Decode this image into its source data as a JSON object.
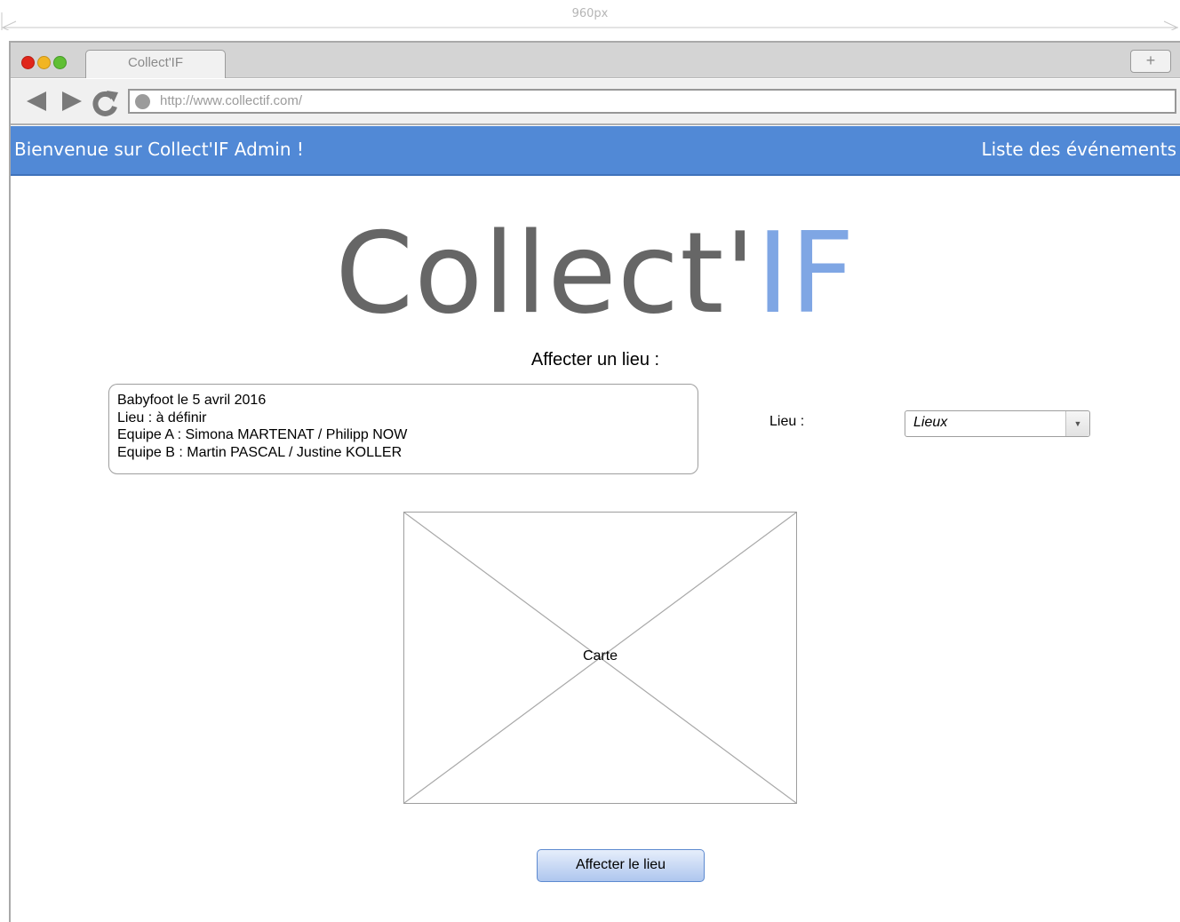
{
  "ruler": {
    "label": "960px"
  },
  "browser": {
    "tab_title": "Collect'IF",
    "new_tab_label": "+",
    "url": "http://www.collectif.com/"
  },
  "header": {
    "welcome": "Bienvenue sur Collect'IF Admin !",
    "events_link": "Liste des événements"
  },
  "logo": {
    "main": "Collect'",
    "accent": "IF"
  },
  "section": {
    "title": "Affecter un lieu :"
  },
  "event": {
    "lines": [
      "Babyfoot le 5 avril 2016",
      "Lieu : à définir",
      "Equipe A : Simona MARTENAT / Philipp NOW",
      "Equipe B : Martin PASCAL / Justine KOLLER"
    ]
  },
  "lieu": {
    "label": "Lieu :",
    "selected": "Lieux"
  },
  "map": {
    "label": "Carte"
  },
  "submit": {
    "label": "Affecter le lieu"
  },
  "colors": {
    "header": "#5189d6",
    "logo_accent": "#7fa6e4",
    "logo_text": "#666666"
  }
}
